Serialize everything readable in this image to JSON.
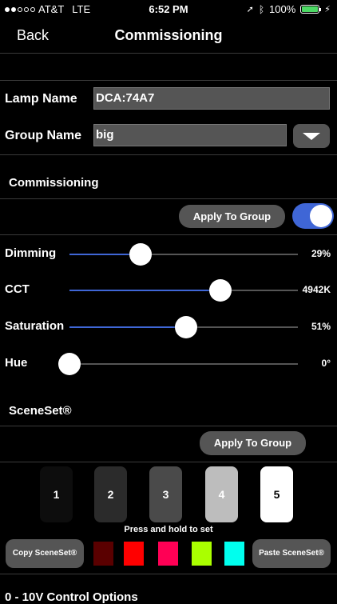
{
  "status": {
    "carrier": "AT&T",
    "network": "LTE",
    "time": "6:52 PM",
    "battery": "100%"
  },
  "nav": {
    "back": "Back",
    "title": "Commissioning"
  },
  "lamp": {
    "label": "Lamp Name",
    "value": "DCA:74A7"
  },
  "group": {
    "label": "Group Name",
    "value": "big"
  },
  "section_commissioning": "Commissioning",
  "apply_group_1": "Apply To Group",
  "toggle_on": true,
  "sliders": [
    {
      "label": "Dimming",
      "value": "29%",
      "fraction": 0.31
    },
    {
      "label": "CCT",
      "value": "4942K",
      "fraction": 0.66
    },
    {
      "label": "Saturation",
      "value": "51%",
      "fraction": 0.51
    },
    {
      "label": "Hue",
      "value": "0°",
      "fraction": 0.0
    }
  ],
  "section_sceneset": "SceneSet®",
  "apply_group_2": "Apply To Group",
  "scenes": [
    {
      "label": "1",
      "bg": "#0d0d0d",
      "fg": "#ffffff"
    },
    {
      "label": "2",
      "bg": "#2b2b2b",
      "fg": "#ffffff"
    },
    {
      "label": "3",
      "bg": "#4a4a4a",
      "fg": "#ffffff"
    },
    {
      "label": "4",
      "bg": "#bdbdbd",
      "fg": "#ffffff"
    },
    {
      "label": "5",
      "bg": "#ffffff",
      "fg": "#000000"
    }
  ],
  "hint": "Press and hold to set",
  "copy_btn": "Copy SceneSet®",
  "paste_btn": "Paste SceneSet®",
  "swatches": [
    "#5a0000",
    "#ff0000",
    "#ff0055",
    "#aaff00",
    "#00ffee"
  ],
  "bottom_section": "0 - 10V Control Options"
}
